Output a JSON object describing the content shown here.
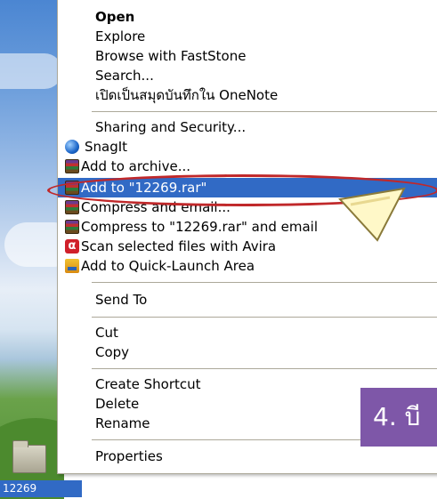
{
  "menu": {
    "items": [
      {
        "label": "Open",
        "icon": "",
        "bold": true
      },
      {
        "label": "Explore",
        "icon": ""
      },
      {
        "label": "Browse with FastStone",
        "icon": ""
      },
      {
        "label": "Search...",
        "icon": ""
      },
      {
        "label": "เปิดเป็นสมุดบันทึกใน OneNote",
        "icon": ""
      },
      {
        "label": "Sharing and Security...",
        "icon": ""
      },
      {
        "label": "SnagIt",
        "icon": "snagit-icon"
      },
      {
        "label": "Add to archive...",
        "icon": "winrar-icon"
      },
      {
        "label": "Add to \"12269.rar\"",
        "icon": "winrar-icon",
        "highlighted": true
      },
      {
        "label": "Compress and email...",
        "icon": "winrar-icon"
      },
      {
        "label": "Compress to \"12269.rar\" and email",
        "icon": "winrar-icon"
      },
      {
        "label": "Scan selected files with Avira",
        "icon": "avira-icon"
      },
      {
        "label": "Add to Quick-Launch Area",
        "icon": "quick-launch-icon"
      },
      {
        "label": "Send To",
        "icon": ""
      },
      {
        "label": "Cut",
        "icon": ""
      },
      {
        "label": "Copy",
        "icon": ""
      },
      {
        "label": "Create Shortcut",
        "icon": ""
      },
      {
        "label": "Delete",
        "icon": ""
      },
      {
        "label": "Rename",
        "icon": ""
      },
      {
        "label": "Properties",
        "icon": ""
      }
    ]
  },
  "desktop": {
    "file_name": "12269"
  },
  "annotation": {
    "step_text": "4. บี"
  },
  "colors": {
    "highlight": "#316ac5",
    "oval": "#c0282a",
    "badge": "#7e57a8"
  }
}
